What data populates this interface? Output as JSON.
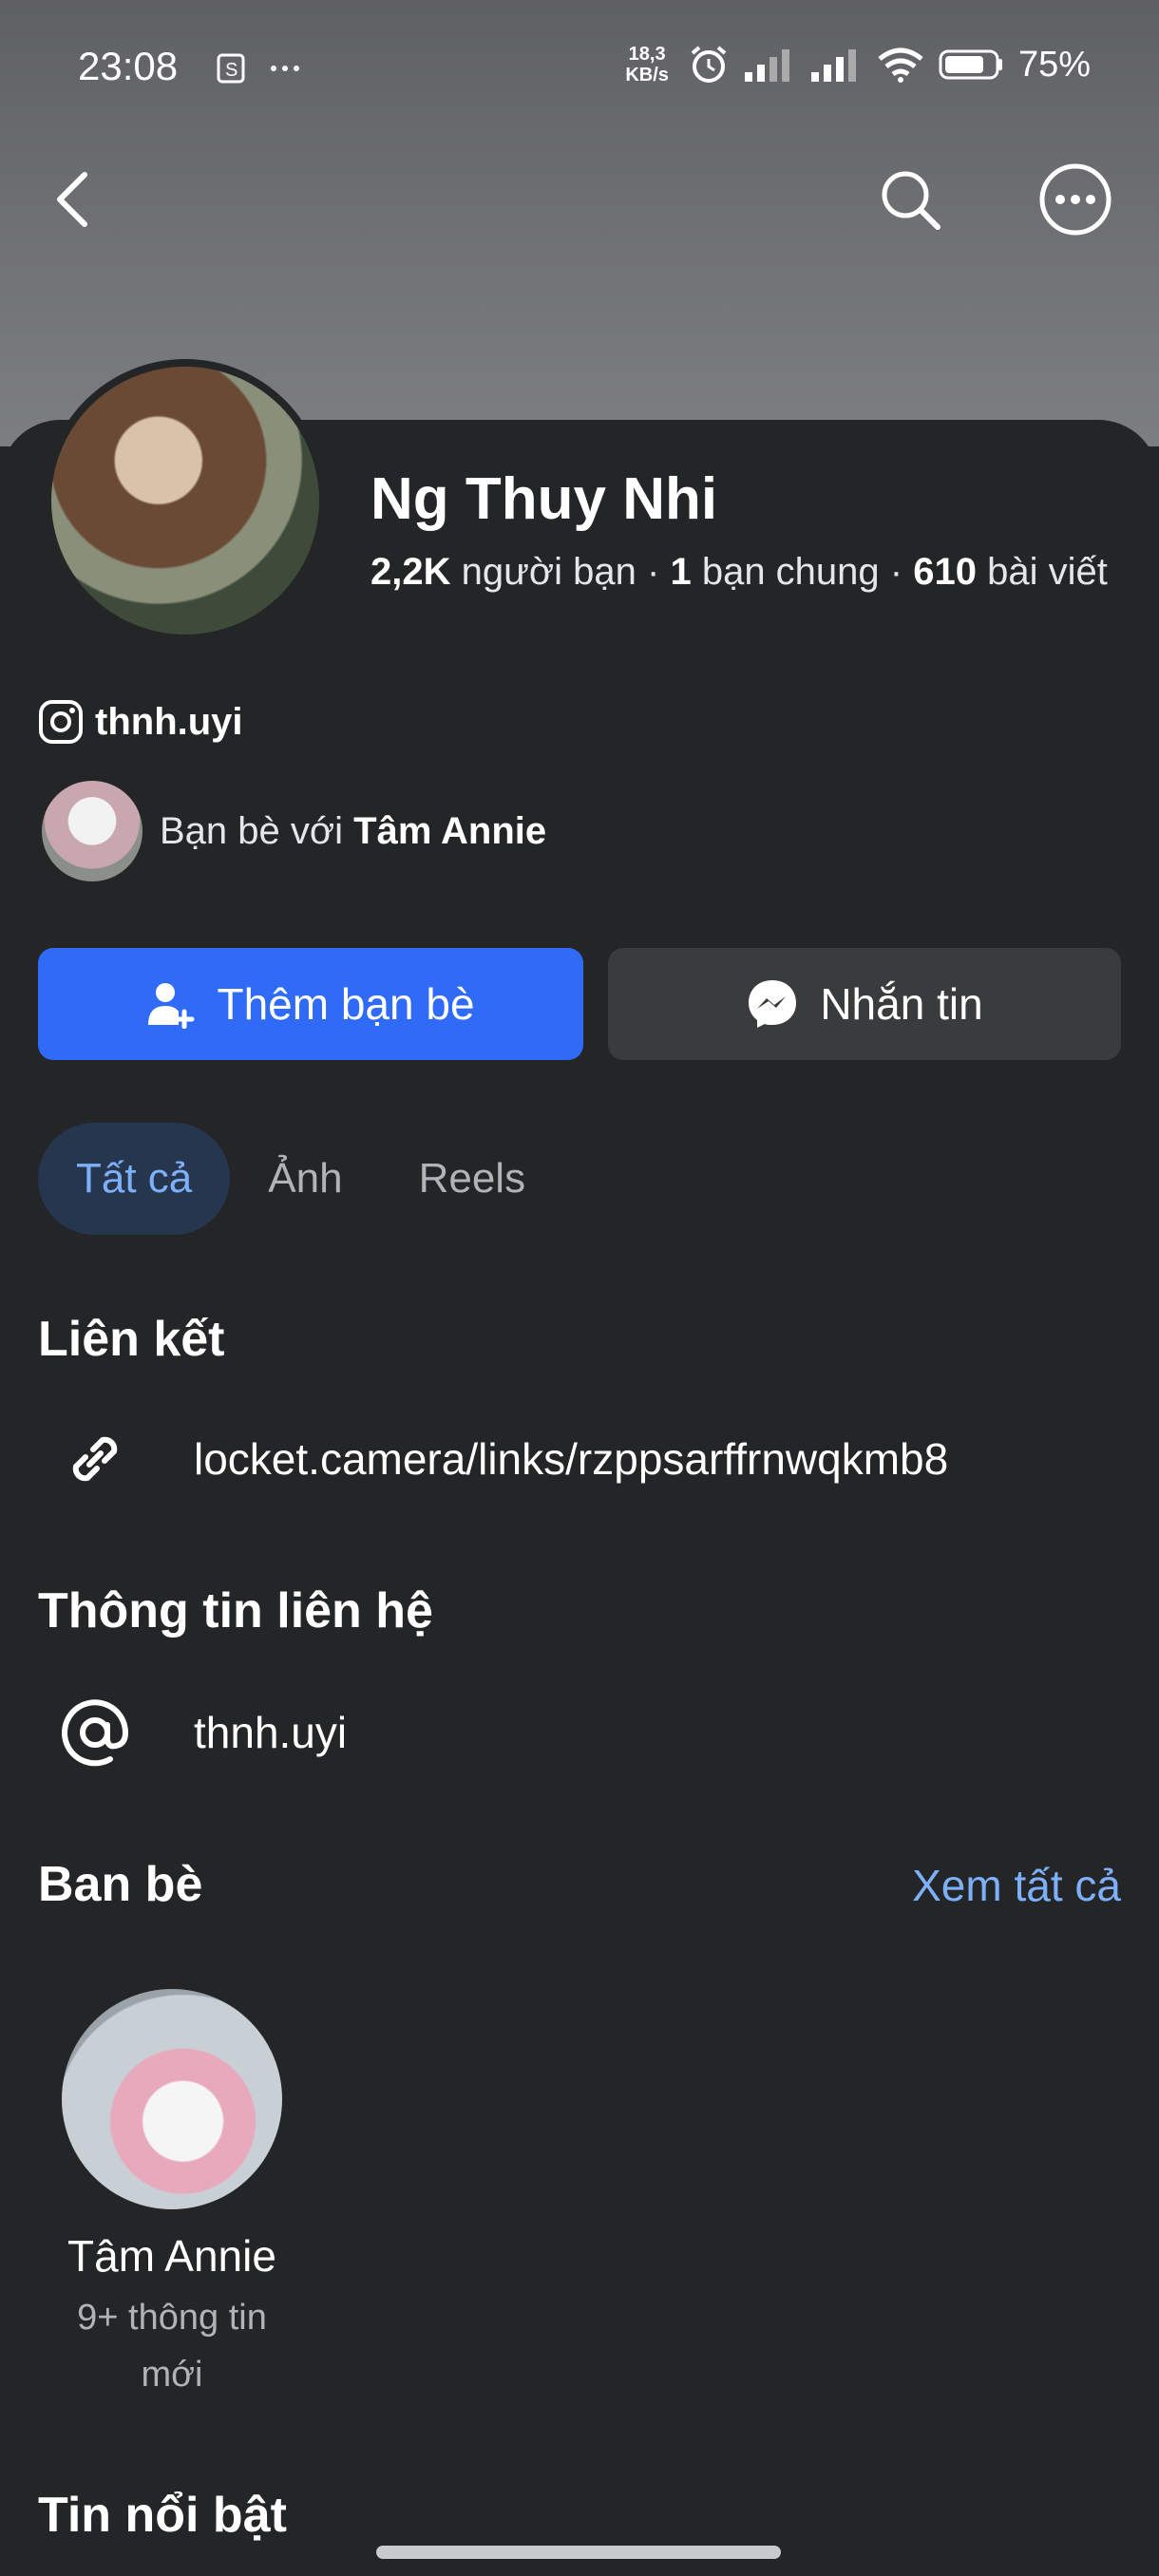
{
  "status_bar": {
    "time": "23:08",
    "net_speed_value": "18,3",
    "net_speed_unit": "KB/s",
    "battery": "75%"
  },
  "profile": {
    "name": "Ng Thuy Nhi",
    "friends_count": "2,2K",
    "friends_label": "người bạn",
    "mutual_count": "1",
    "mutual_label": "bạn chung",
    "posts_count": "610",
    "posts_label": "bài viết",
    "separator": "·",
    "instagram": "thnh.uyi",
    "mutual_prefix": "Bạn bè với",
    "mutual_name": "Tâm Annie"
  },
  "actions": {
    "add_friend": "Thêm bạn bè",
    "message": "Nhắn tin"
  },
  "tabs": [
    "Tất cả",
    "Ảnh",
    "Reels"
  ],
  "links": {
    "title": "Liên kết",
    "url": "locket.camera/links/rzppsarffrnwqkmb8"
  },
  "contact": {
    "title": "Thông tin liên hệ",
    "handle": "thnh.uyi"
  },
  "friends": {
    "title": "Ban bè",
    "see_all": "Xem tất cả",
    "items": [
      {
        "name": "Tâm Annie",
        "sub": "9+ thông tin mới"
      }
    ]
  },
  "highlights": {
    "title": "Tin nổi bật"
  },
  "colors": {
    "primary": "#2f6bf7",
    "link": "#7eb0f9",
    "background": "#242526"
  }
}
